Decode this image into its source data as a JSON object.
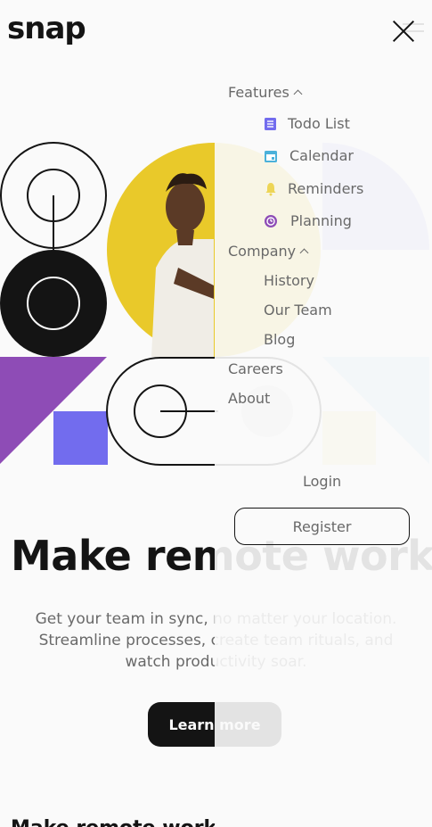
{
  "header": {
    "logo": "snap"
  },
  "hero": {
    "headline": "Make remote work",
    "description_lines": [
      "Get your team in sync, no matter your location.",
      "Streamline processes, create team rituals, and",
      "watch productivity soar."
    ],
    "cta_label": "Learn more",
    "next_section_partial": "Make remote work"
  },
  "menu": {
    "features": {
      "label": "Features",
      "items": [
        {
          "label": "Todo List",
          "icon": "todo-list-icon",
          "color": "#726cee"
        },
        {
          "label": "Calendar",
          "icon": "calendar-icon",
          "color": "#4bb1da"
        },
        {
          "label": "Reminders",
          "icon": "bell-icon",
          "color": "#edd556"
        },
        {
          "label": "Planning",
          "icon": "planning-icon",
          "color": "#8e4cb6"
        }
      ]
    },
    "company": {
      "label": "Company",
      "items": [
        {
          "label": "History"
        },
        {
          "label": "Our Team"
        },
        {
          "label": "Blog"
        }
      ]
    },
    "careers": "Careers",
    "about": "About",
    "login": "Login",
    "register": "Register"
  },
  "colors": {
    "dark": "#141414",
    "gray": "#696969",
    "yellow": "#e9c92a",
    "purple": "#8e4cb6",
    "violet": "#726cee"
  }
}
